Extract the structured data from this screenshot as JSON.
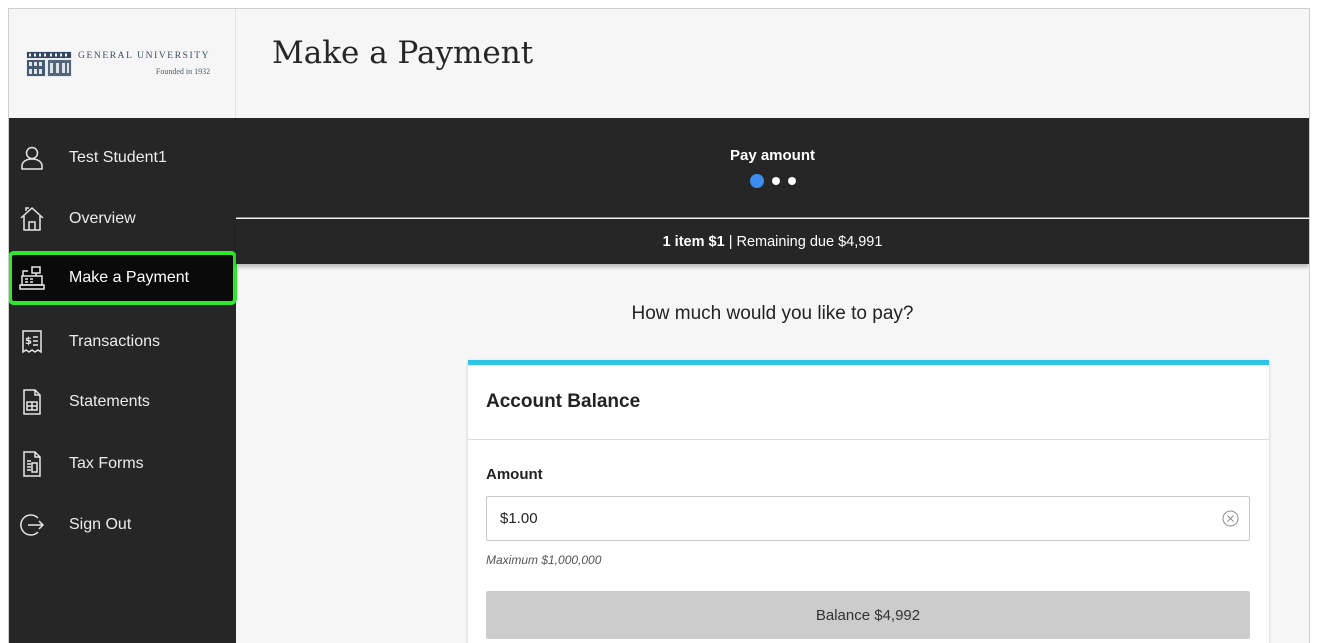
{
  "logo": {
    "name": "GENERAL UNIVERSITY",
    "founded": "Founded in 1932"
  },
  "header": {
    "title": "Make a Payment"
  },
  "sidebar": {
    "items": [
      {
        "label": "Test Student1",
        "icon": "user-icon",
        "active": false
      },
      {
        "label": "Overview",
        "icon": "home-icon",
        "active": false
      },
      {
        "label": "Make a Payment",
        "icon": "cash-register-icon",
        "active": true
      },
      {
        "label": "Transactions",
        "icon": "receipt-icon",
        "active": false
      },
      {
        "label": "Statements",
        "icon": "statement-icon",
        "active": false
      },
      {
        "label": "Tax Forms",
        "icon": "tax-form-icon",
        "active": false
      },
      {
        "label": "Sign Out",
        "icon": "sign-out-icon",
        "active": false
      }
    ],
    "highlight_color": "#2ee82e"
  },
  "steps": {
    "current_label": "Pay amount",
    "total": 3,
    "current": 1
  },
  "summary": {
    "items_text": "1 item $1",
    "separator": "|",
    "remaining_text": "Remaining due $4,991"
  },
  "main": {
    "question": "How much would you like to pay?",
    "card": {
      "title": "Account Balance",
      "amount_label": "Amount",
      "amount_value": "$1.00",
      "max_hint": "Maximum $1,000,000",
      "balance_button": "Balance $4,992"
    }
  },
  "colors": {
    "sidebar_bg": "#262626",
    "accent_blue": "#3b8ef0",
    "card_top_border": "#2dc4e6"
  }
}
